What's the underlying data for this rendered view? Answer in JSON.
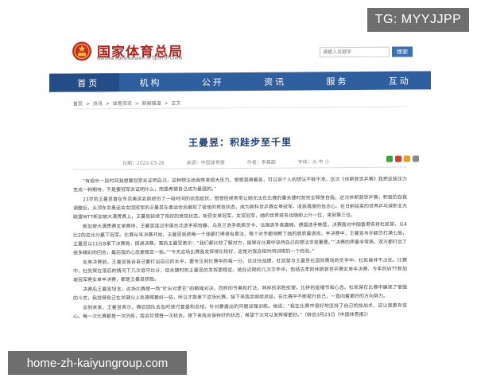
{
  "watermarks": {
    "top": "TG: MYYJJPP",
    "bottom": "home-zh-kaiyungroup.com"
  },
  "header": {
    "title": "国家体育总局",
    "subtitle": "General Administration of Sport of China",
    "search_placeholder": "请输入关键字",
    "search_button": "搜索",
    "brand_color": "#b3231f"
  },
  "nav": {
    "items": [
      "首页",
      "机构",
      "公开",
      "资讯",
      "服务",
      "互动"
    ],
    "color": "#2f5f9e"
  },
  "breadcrumb": [
    "首页",
    ">",
    "资讯",
    ">",
    "体育资讯",
    ">",
    "新闻报道",
    ">",
    "正文"
  ],
  "article": {
    "title": "王曼昱：积跬步至千里",
    "meta": {
      "date": "日期：2022-03-26",
      "source": "来源：中国体育报",
      "author": "作者：李晨超",
      "font_size": "字体：大 中 小"
    },
    "paragraphs": [
      "“有很长一段时间我想要冠军去证明自己，这种想法给我带来很大压力。想想我很着急，可以说个人的想法不够干净。这次《休斯敦世乒赛》我把这些压力变成一种期待，不是要冠军去证明什么，而是希望自己成为最强的。”",
      "23岁的王曼昱曾在东京奥运会前经历了一段时间的状态起伏，想想但候常常让她无法在比赛的重关键时刻完全释放自我。这次休斯敦世乒赛，积极的自我调整后，头顶东京奥运会女团冠军的王曼昱在奥运会后展现了极佳的竞技状态，成为新科世乒赛女单冠军，收获再度的信念心。在日前结束的世界乒乓球职业大联盟WTT新加坡大满贯赛上，王曼昱延续了良好的竞技状态，斩获女单冠军、女双冠军，她的世界排名也随即上升一位，来到第三位。",
      "新加坡大满贯赛女单赛场，王曼昱连过中国台北选手郑怡静、乌克兰选手佩索茨卡、法国选手袁嘉楠、德国选手韩莹，决赛面对中国香港名将杜凯琹，以4比2的总比分赢下冠军。比赛从半决赛开始，王曼昱就把每一个球都打得很有章法，每个对手都领教了她的高质量进攻。半决赛中，王曼昱与孙颖莎打满七局，王曼昱以11比8拿下决赛局，挺进决赛。赛后王曼昱表示：“我们都比较了解对方，能够在比赛中坚持自己的想法非常重要。”“决赛的质量非常高，双方都打出了很多精彩的回合，最后我的心态更稳定一些。”“今天这场比赛我发挥得比较好，这是对我这段时间训练的一个检验。”",
      "女单决赛前，王曼昱告诉自己要打出自己的水平，要专注到比赛中的每一分。论过往战绩，杜凯琹与王曼昱在国际赛场的交手中，杜凯琹并不占优。比赛中，杜凯琹在落后的情况下几次追平比分，但关键时刻王曼昱的发挥更稳定。她在近期的几次交手中，包括去年的休斯敦世乒赛女单半决赛、今年的WTT新加坡冠军赛女单半决赛，都是王曼昱获胜。",
      "决赛后王曼昱坦言，这场比赛是一场“针尖对麦芒”的巅峰对决。同样的节奏和打法，同样的求胜欲望，比拼的是细节和心态。杜凯琹在比赛中展现了很强的斗志，我觉得自己在关键分上处理得更好一些，所以才能拿下这场比赛。接下来我会继续总结，在比赛中不断提升自己，一直向着更好的方向努力。",
      "谈到未来，王曼昱表示，赛后团队会及时进行复盘和总结，针对暴露出的问题加强训练。她说：“我在比赛中很好地坚持了自己的技战术，这让我更有信心。每一次比赛都是一次历练，我会珍惜每一次机会。接下来我会保持好的状态，希望下次可以发挥得更好。”（转自3月23日《中国体育报》）"
    ]
  }
}
